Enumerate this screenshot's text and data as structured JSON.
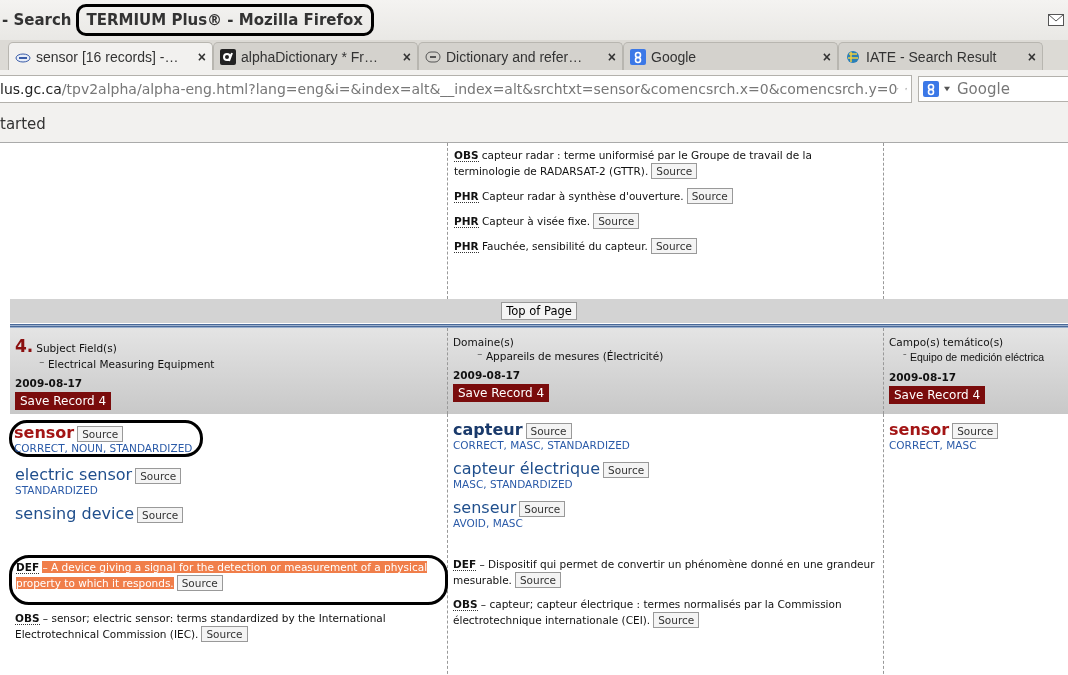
{
  "window": {
    "title_prefix": "- Search",
    "title": "TERMIUM Plus® - Mozilla Firefox",
    "title_circled": true
  },
  "tabs": [
    {
      "label": "sensor [16 records] -…",
      "kind": "btb",
      "selected": true,
      "close": "×"
    },
    {
      "label": "alphaDictionary * Fr…",
      "kind": "alpha",
      "selected": false,
      "close": "×"
    },
    {
      "label": "Dictionary and refer…",
      "kind": "bubble",
      "selected": false,
      "close": "×"
    },
    {
      "label": "Google",
      "kind": "google",
      "selected": false,
      "close": "×"
    },
    {
      "label": "IATE - Search Result",
      "kind": "iate",
      "selected": false,
      "close": "×"
    }
  ],
  "url": {
    "host": "lus.gc.ca",
    "path": "/tpv2alpha/alpha-eng.html?lang=eng&i=&index=alt&__index=alt&srchtxt=sensor&comencsrch.x=0&comencsrch.y=0"
  },
  "search": {
    "placeholder": "Google"
  },
  "bookmarks": [
    "tarted"
  ],
  "previous_notes": [
    {
      "label": "OBS",
      "text": "capteur radar : terme uniformisé par le Groupe de travail de la terminologie de RADARSAT-2 (GTTR).",
      "source": "Source"
    },
    {
      "label": "PHR",
      "text": "Capteur radar à synthèse d'ouverture.",
      "source": "Source"
    },
    {
      "label": "PHR",
      "text": "Capteur à visée fixe.",
      "source": "Source"
    },
    {
      "label": "PHR",
      "text": "Fauchée, sensibilité du capteur.",
      "source": "Source"
    }
  ],
  "top_of_page": "Top of Page",
  "record": {
    "number": "4.",
    "columns": [
      {
        "field_label": "Subject Field(s)",
        "dash": "⁻",
        "field_value": "Electrical Measuring Equipment",
        "date": "2009-08-17",
        "save": "Save Record 4",
        "terms": [
          {
            "term": "sensor",
            "primary": true,
            "color": "#a31515",
            "source": "Source",
            "tags": "CORRECT, NOUN, STANDARDIZED",
            "circled": true
          },
          {
            "term": "electric sensor",
            "primary": false,
            "color": "#1f4e8c",
            "source": "Source",
            "tags": "STANDARDIZED",
            "circled": false
          },
          {
            "term": "sensing device",
            "primary": false,
            "color": "#1f4e8c",
            "source": "Source",
            "circled": false
          }
        ],
        "notes": [
          {
            "label": "DEF",
            "text": "– A device giving a signal for the detection or measurement of a physical property to which it responds.",
            "source": "Source",
            "highlighted": true,
            "circled": true
          },
          {
            "label": "OBS",
            "text": "– sensor; electric sensor: terms standardized by the International Electrotechnical Commission (IEC).",
            "source": "Source",
            "highlighted": false,
            "circled": false
          }
        ]
      },
      {
        "field_label": "Domaine(s)",
        "dash": "⁻",
        "field_value": "Appareils de mesures (Électricité)",
        "date": "2009-08-17",
        "save": "Save Record 4",
        "terms": [
          {
            "term": "capteur",
            "primary": true,
            "color": "#1a3a6b",
            "source": "Source",
            "tags": "CORRECT, MASC, STANDARDIZED",
            "circled": false
          },
          {
            "term": "capteur électrique",
            "primary": false,
            "color": "#1f4e8c",
            "source": "Source",
            "tags": "MASC, STANDARDIZED",
            "circled": false
          },
          {
            "term": "senseur",
            "primary": false,
            "color": "#1f4e8c",
            "source": "Source",
            "tags": "AVOID, MASC",
            "circled": false
          }
        ],
        "notes": [
          {
            "label": "DEF",
            "text": "– Dispositif qui permet de convertir un phénomène donné en une grandeur mesurable.",
            "source": "Source",
            "highlighted": false,
            "circled": false
          },
          {
            "label": "OBS",
            "text": "– capteur; capteur électrique : termes normalisés par la Commission électrotechnique internationale (CEI).",
            "source": "Source",
            "highlighted": false,
            "circled": false
          }
        ]
      },
      {
        "field_label": "Campo(s) temático(s)",
        "dash": "⁻",
        "field_value": "Equipo de medición eléctrica",
        "date": "2009-08-17",
        "save": "Save Record 4",
        "terms": [
          {
            "term": "sensor",
            "primary": true,
            "color": "#a31515",
            "source": "Source",
            "tags": "CORRECT, MASC",
            "circled": false
          }
        ]
      }
    ]
  }
}
